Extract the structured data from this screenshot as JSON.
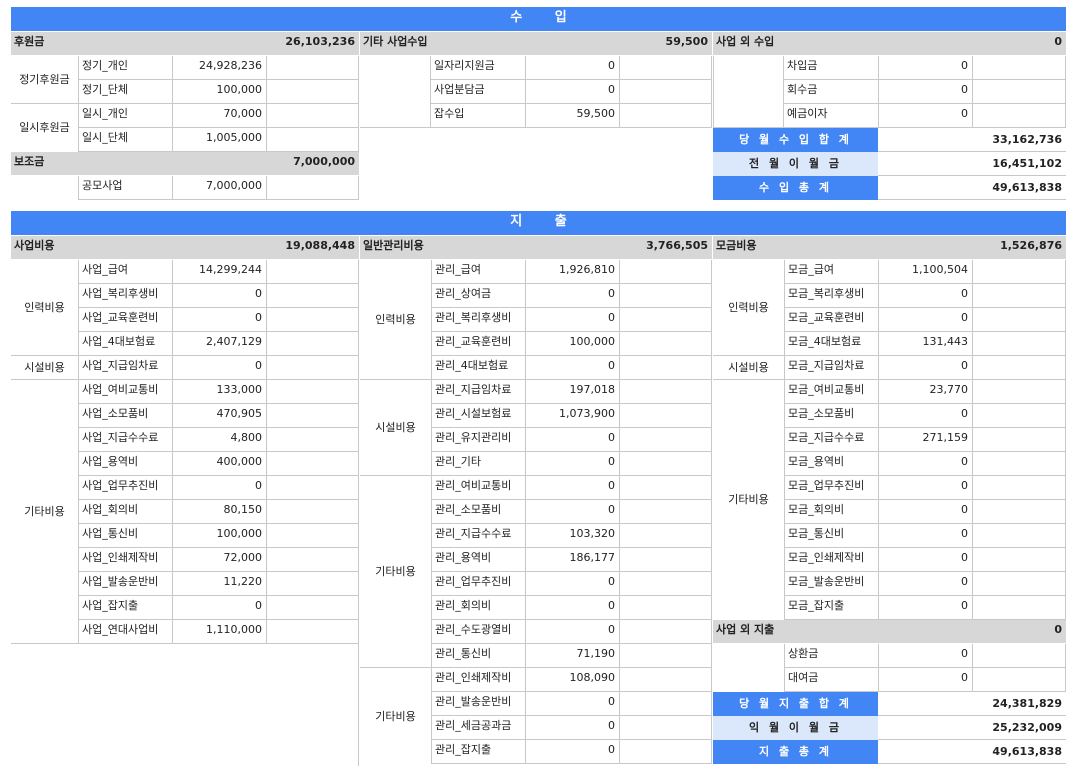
{
  "income": {
    "title": "수 입",
    "col1": {
      "header": {
        "label": "후원금",
        "value": "26,103,236"
      },
      "groups": [
        {
          "name": "정기후원금",
          "rows": [
            {
              "label": "정기_개인",
              "value": "24,928,236"
            },
            {
              "label": "정기_단체",
              "value": "100,000"
            }
          ]
        },
        {
          "name": "일시후원금",
          "rows": [
            {
              "label": "일시_개인",
              "value": "70,000"
            },
            {
              "label": "일시_단체",
              "value": "1,005,000"
            }
          ]
        }
      ],
      "header2": {
        "label": "보조금",
        "value": "7,000,000"
      },
      "rows2": [
        {
          "label": "공모사업",
          "value": "7,000,000"
        }
      ]
    },
    "col2": {
      "header": {
        "label": "기타 사업수입",
        "value": "59,500"
      },
      "rows": [
        {
          "label": "일자리지원금",
          "value": "0"
        },
        {
          "label": "사업분담금",
          "value": "0"
        },
        {
          "label": "잡수입",
          "value": "59,500"
        }
      ]
    },
    "col3": {
      "header": {
        "label": "사업 외 수입",
        "value": "0"
      },
      "rows": [
        {
          "label": "차입금",
          "value": "0"
        },
        {
          "label": "회수금",
          "value": "0"
        },
        {
          "label": "예금이자",
          "value": "0"
        }
      ]
    },
    "summary": [
      {
        "label": "당 월 수 입 합 계",
        "value": "33,162,736"
      },
      {
        "label": "전 월 이 월 금",
        "value": "16,451,102"
      },
      {
        "label": "수 입 총 계",
        "value": "49,613,838"
      }
    ]
  },
  "expense": {
    "title": "지 출",
    "col1": {
      "header": {
        "label": "사업비용",
        "value": "19,088,448"
      },
      "groups": [
        {
          "name": "인력비용",
          "rows": [
            {
              "label": "사업_급여",
              "value": "14,299,244"
            },
            {
              "label": "사업_복리후생비",
              "value": "0"
            },
            {
              "label": "사업_교육훈련비",
              "value": "0"
            },
            {
              "label": "사업_4대보험료",
              "value": "2,407,129"
            }
          ]
        },
        {
          "name": "시설비용",
          "rows": [
            {
              "label": "사업_지급임차료",
              "value": "0"
            }
          ]
        },
        {
          "name": "기타비용",
          "rows": [
            {
              "label": "사업_여비교통비",
              "value": "133,000"
            },
            {
              "label": "사업_소모품비",
              "value": "470,905"
            },
            {
              "label": "사업_지급수수료",
              "value": "4,800"
            },
            {
              "label": "사업_용역비",
              "value": "400,000"
            },
            {
              "label": "사업_업무추진비",
              "value": "0"
            },
            {
              "label": "사업_회의비",
              "value": "80,150"
            },
            {
              "label": "사업_통신비",
              "value": "100,000"
            },
            {
              "label": "사업_인쇄제작비",
              "value": "72,000"
            },
            {
              "label": "사업_발송운반비",
              "value": "11,220"
            },
            {
              "label": "사업_잡지출",
              "value": "0"
            },
            {
              "label": "사업_연대사업비",
              "value": "1,110,000"
            }
          ]
        }
      ]
    },
    "col2": {
      "header": {
        "label": "일반관리비용",
        "value": "3,766,505"
      },
      "groups": [
        {
          "name": "인력비용",
          "rows": [
            {
              "label": "관리_급여",
              "value": "1,926,810"
            },
            {
              "label": "관리_상여금",
              "value": "0"
            },
            {
              "label": "관리_복리후생비",
              "value": "0"
            },
            {
              "label": "관리_교육훈련비",
              "value": "100,000"
            },
            {
              "label": "관리_4대보험료",
              "value": "0"
            }
          ]
        },
        {
          "name": "시설비용",
          "rows": [
            {
              "label": "관리_지급임차료",
              "value": "197,018"
            },
            {
              "label": "관리_시설보험료",
              "value": "1,073,900"
            },
            {
              "label": "관리_유지관리비",
              "value": "0"
            },
            {
              "label": "관리_기타",
              "value": "0"
            }
          ]
        },
        {
          "name": "기타비용",
          "rows": [
            {
              "label": "관리_여비교통비",
              "value": "0"
            },
            {
              "label": "관리_소모품비",
              "value": "0"
            },
            {
              "label": "관리_지급수수료",
              "value": "103,320"
            },
            {
              "label": "관리_용역비",
              "value": "186,177"
            },
            {
              "label": "관리_업무추진비",
              "value": "0"
            },
            {
              "label": "관리_회의비",
              "value": "0"
            },
            {
              "label": "관리_수도광열비",
              "value": "0"
            },
            {
              "label": "관리_통신비",
              "value": "71,190"
            }
          ]
        },
        {
          "name": "기타비용",
          "rows": [
            {
              "label": "관리_인쇄제작비",
              "value": "108,090"
            },
            {
              "label": "관리_발송운반비",
              "value": "0"
            },
            {
              "label": "관리_세금공과금",
              "value": "0"
            },
            {
              "label": "관리_잡지출",
              "value": "0"
            }
          ]
        }
      ]
    },
    "col3": {
      "header": {
        "label": "모금비용",
        "value": "1,526,876"
      },
      "groups": [
        {
          "name": "인력비용",
          "rows": [
            {
              "label": "모금_급여",
              "value": "1,100,504"
            },
            {
              "label": "모금_복리후생비",
              "value": "0"
            },
            {
              "label": "모금_교육훈련비",
              "value": "0"
            },
            {
              "label": "모금_4대보험료",
              "value": "131,443"
            }
          ]
        },
        {
          "name": "시설비용",
          "rows": [
            {
              "label": "모금_지급임차료",
              "value": "0"
            }
          ]
        },
        {
          "name": "기타비용",
          "rows": [
            {
              "label": "모금_여비교통비",
              "value": "23,770"
            },
            {
              "label": "모금_소모품비",
              "value": "0"
            },
            {
              "label": "모금_지급수수료",
              "value": "271,159"
            },
            {
              "label": "모금_용역비",
              "value": "0"
            },
            {
              "label": "모금_업무추진비",
              "value": "0"
            },
            {
              "label": "모금_회의비",
              "value": "0"
            },
            {
              "label": "모금_통신비",
              "value": "0"
            },
            {
              "label": "모금_인쇄제작비",
              "value": "0"
            },
            {
              "label": "모금_발송운반비",
              "value": "0"
            },
            {
              "label": "모금_잡지출",
              "value": "0"
            }
          ]
        }
      ],
      "header2": {
        "label": "사업 외 지출",
        "value": "0"
      },
      "rows2": [
        {
          "label": "상환금",
          "value": "0"
        },
        {
          "label": "대여금",
          "value": "0"
        }
      ]
    },
    "summary": [
      {
        "label": "당 월 지 출 합 계",
        "value": "24,381,829"
      },
      {
        "label": "익 월 이 월 금",
        "value": "25,232,009"
      },
      {
        "label": "지 출 총 계",
        "value": "49,613,838"
      }
    ]
  }
}
